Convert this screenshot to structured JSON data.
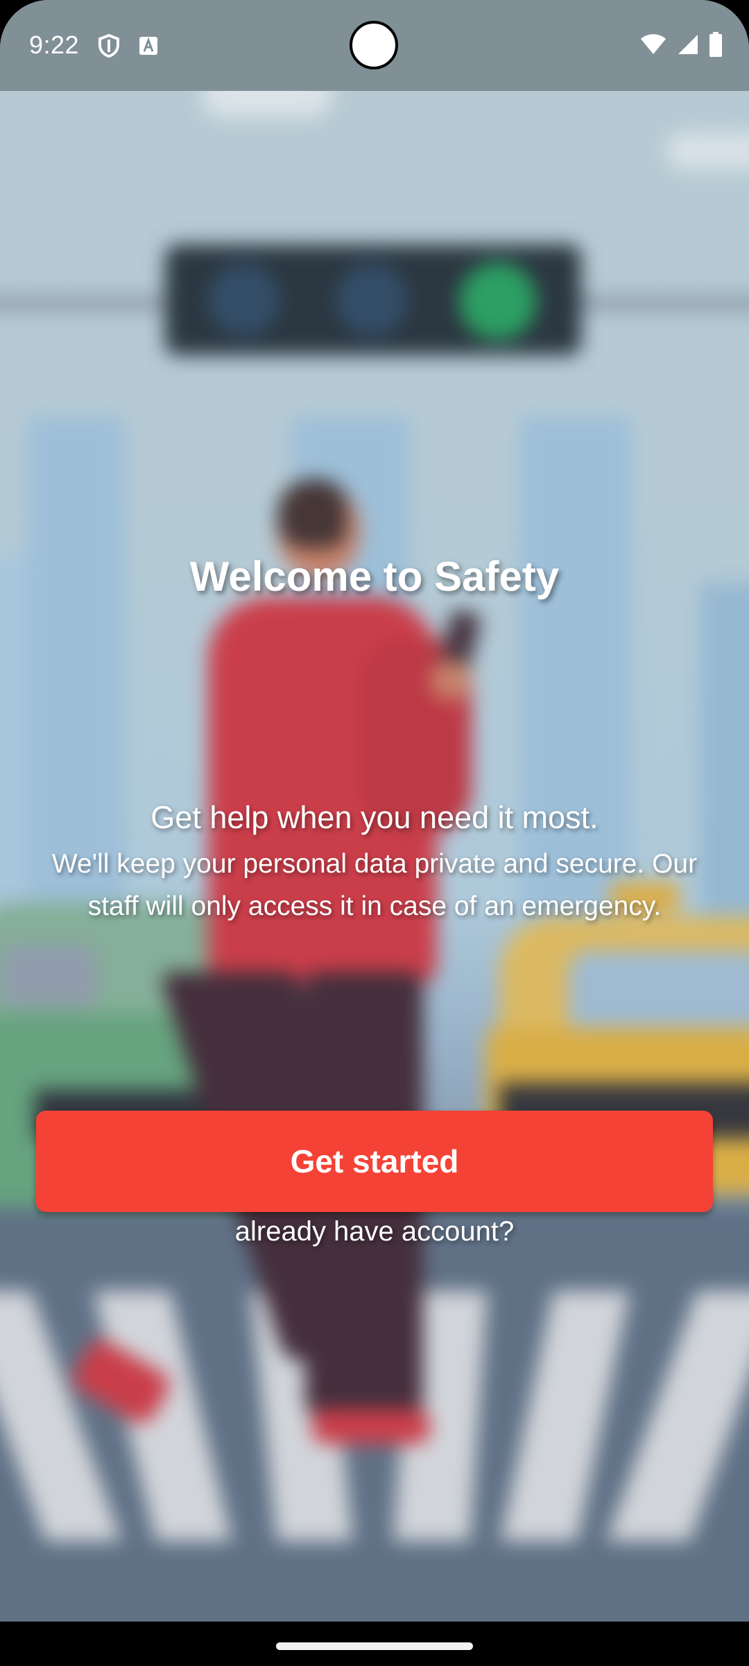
{
  "status_bar": {
    "time": "9:22",
    "left_icons": [
      "shield-icon",
      "font-a-icon"
    ],
    "right_icons": [
      "wifi-icon",
      "cellular-signal-icon",
      "battery-icon"
    ]
  },
  "welcome": {
    "title": "Welcome to Safety",
    "tagline": "Get help when you need it most.",
    "privacy_line_1": "We'll keep your personal data private and secure. Our",
    "privacy_line_2": "staff will only access it in case of an emergency."
  },
  "actions": {
    "get_started_label": "Get started",
    "existing_account_label": "already have account?"
  },
  "colors": {
    "primary_button": "#f44336",
    "status_bar": "#818f97",
    "text": "#ffffff"
  },
  "background_illustration": "pedestrian-crossing-street-with-phone"
}
